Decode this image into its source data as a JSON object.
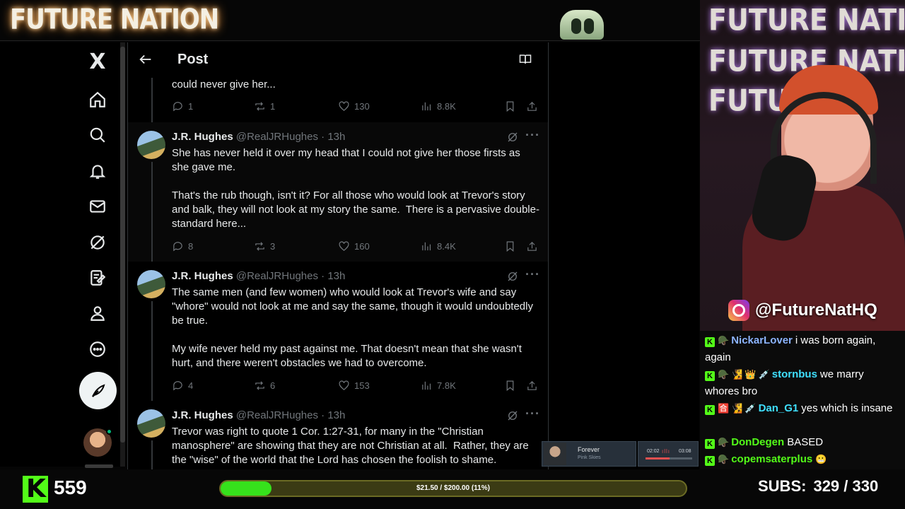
{
  "stream": {
    "banner_title": "FUTURE NATION",
    "cam_watermark": [
      "FUTURE NATION",
      "FUTURE NATION",
      "FUTURE"
    ],
    "instagram_handle": "@FutureNatHQ",
    "viewer_count": "559",
    "goal_text": "$21.50 / $200.00 (11%)",
    "goal_progress": 0.11,
    "subs_label": "SUBS:",
    "subs_value": "329 / 330"
  },
  "music": {
    "song": "Forever",
    "artist": "Pink Skies",
    "time_current": "02:02",
    "time_total": "03:08",
    "progress": 0.52
  },
  "x_sidebar": {
    "items": [
      {
        "name": "x-logo",
        "label": "X"
      },
      {
        "name": "home-icon"
      },
      {
        "name": "search-icon"
      },
      {
        "name": "bell-icon"
      },
      {
        "name": "mail-icon"
      },
      {
        "name": "grok-icon"
      },
      {
        "name": "lists-icon"
      },
      {
        "name": "profile-icon"
      },
      {
        "name": "more-icon"
      }
    ]
  },
  "header": {
    "title": "Post"
  },
  "tweets": [
    {
      "text": "could never give her...",
      "replies": "1",
      "reposts": "1",
      "likes": "130",
      "views": "8.8K"
    },
    {
      "name": "J.R. Hughes",
      "handle": "@RealJRHughes",
      "time": "13h",
      "text": "She has never held it over my head that I could not give her those firsts as she gave me.\n\nThat's the rub though, isn't it? For all those who would look at Trevor's story and balk, they will not look at my story the same.  There is a pervasive double-standard here...",
      "replies": "8",
      "reposts": "3",
      "likes": "160",
      "views": "8.4K"
    },
    {
      "name": "J.R. Hughes",
      "handle": "@RealJRHughes",
      "time": "13h",
      "text": "The same men (and few women) who would look at Trevor's wife and say \"whore\" would not look at me and say the same, though it would undoubtedly be true.\n\nMy wife never held my past against me. That doesn't mean that she wasn't hurt, and there weren't obstacles we had to overcome.",
      "replies": "4",
      "reposts": "6",
      "likes": "153",
      "views": "7.8K"
    },
    {
      "name": "J.R. Hughes",
      "handle": "@RealJRHughes",
      "time": "13h",
      "text": "Trevor was right to quote 1 Cor. 1:27-31, for many in the \"Christian manosphere\" are showing that they are not Christian at all.  Rather, they are the \"wise\" of the world that the Lord has chosen the foolish to shame."
    }
  ],
  "chat": [
    {
      "user": "NickarLover",
      "color": "#8cb4ff",
      "message": "i was born again, again",
      "emotes": [
        "🪖"
      ]
    },
    {
      "user": "stornbus",
      "color": "#3fe0ff",
      "message": "we marry whores bro",
      "emotes": [
        "🪖",
        "🧏",
        "👑",
        "💉"
      ]
    },
    {
      "user": "Dan_G1",
      "color": "#3fe0ff",
      "message": "yes which is insane",
      "emotes": [
        "🪖",
        "🈴",
        "🧏",
        "💉"
      ]
    },
    {
      "user": "DonDegen",
      "color": "#53fc18",
      "message": "BASED",
      "emotes": [
        "🪖"
      ]
    },
    {
      "user": "copemsaterplus",
      "color": "#53fc18",
      "message": "",
      "emotes": [
        "🪖"
      ]
    }
  ],
  "colors": {
    "kick_green": "#53fc18",
    "x_text": "#e7e9ea",
    "x_muted": "#71767b",
    "x_border": "#2f3336"
  }
}
